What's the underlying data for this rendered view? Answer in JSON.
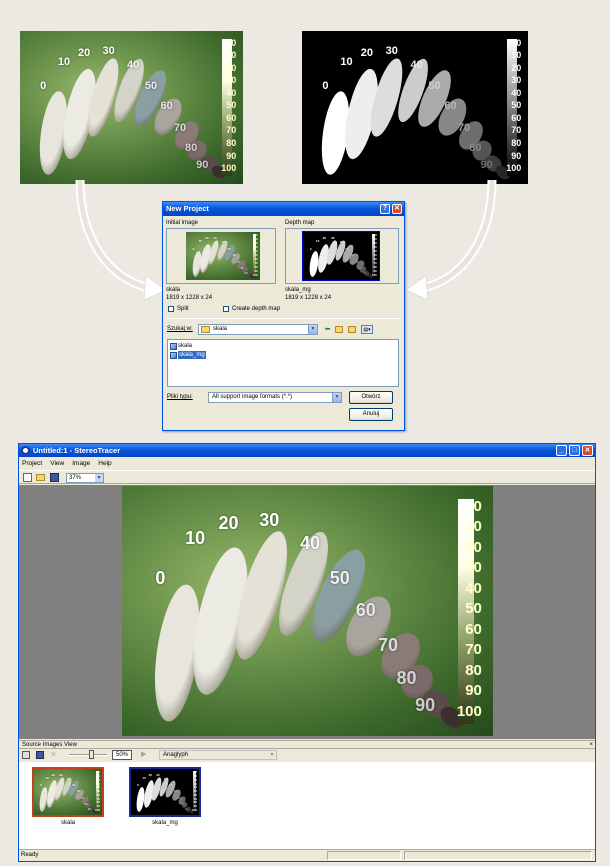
{
  "artwork": {
    "stone_labels": [
      "0",
      "10",
      "20",
      "30",
      "40",
      "50",
      "60",
      "70",
      "80",
      "90"
    ],
    "scale_labels": [
      "0",
      "10",
      "20",
      "30",
      "40",
      "50",
      "60",
      "70",
      "80",
      "90",
      "100"
    ]
  },
  "dialog": {
    "title": "New Project",
    "help_btn": "?",
    "close_btn": "✕",
    "initial_image_label": "Initial image",
    "depth_map_label": "Depth map",
    "initial_name": "skala",
    "initial_size": "1819 x 1228 x 24",
    "depth_name": "skala_mg",
    "depth_size": "1819 x 1228 x 24",
    "split_label": "Split",
    "create_depth_label": "Create depth map",
    "look_in_label": "Szukaj w:",
    "look_in_value": "skala",
    "files": [
      "skala",
      "skala_mg"
    ],
    "file_type_label": "Pliki typu:",
    "file_type_value": "All support image formats (*.*)",
    "open_btn": "Otwórz",
    "cancel_btn": "Anuluj"
  },
  "app": {
    "title": "Untitled:1 - StereoTracer",
    "menu": [
      "Project",
      "View",
      "Image",
      "Help"
    ],
    "zoom": "37%",
    "source_view_title": "Source Images View",
    "source_close": "×",
    "thumb_zoom": "50%",
    "mode": "Anaglyph",
    "thumb_labels": [
      "skala",
      "skala_mg"
    ],
    "status": "Ready",
    "colors": {
      "titlebar": "#0a56d8",
      "selection": "#316ac5",
      "initial_frame": "#c04020",
      "depth_frame": "#1a2a90"
    }
  }
}
